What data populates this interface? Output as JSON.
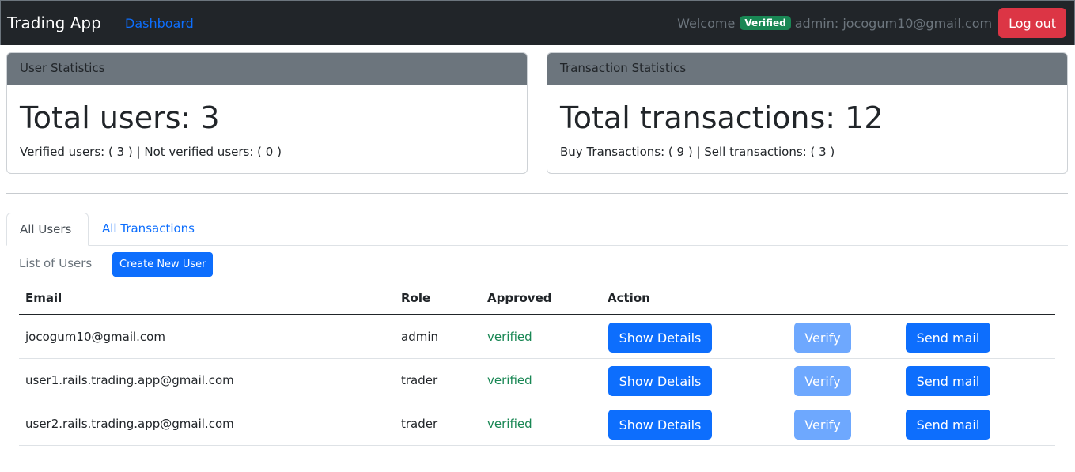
{
  "navbar": {
    "brand": "Trading App",
    "dashboard_link": "Dashboard",
    "welcome": "Welcome",
    "badge": "Verified",
    "admin_text": "admin: jocogum10@gmail.com",
    "logout": "Log out"
  },
  "user_stats": {
    "header": "User Statistics",
    "title": "Total users: 3",
    "text": "Verified users: ( 3 ) | Not verified users: ( 0 )"
  },
  "txn_stats": {
    "header": "Transaction Statistics",
    "title": "Total transactions: 12",
    "text": "Buy Transactions: ( 9 ) | Sell transactions: ( 3 )"
  },
  "tabs": [
    {
      "label": "All Users",
      "active": true
    },
    {
      "label": "All Transactions",
      "active": false
    }
  ],
  "users_section": {
    "label": "List of Users",
    "create_button": "Create New User"
  },
  "table": {
    "headers": {
      "email": "Email",
      "role": "Role",
      "approved": "Approved",
      "action": "Action"
    },
    "rows": [
      {
        "email": "jocogum10@gmail.com",
        "role": "admin",
        "approved": "verified",
        "show": "Show Details",
        "verify": "Verify",
        "mail": "Send mail"
      },
      {
        "email": "user1.rails.trading.app@gmail.com",
        "role": "trader",
        "approved": "verified",
        "show": "Show Details",
        "verify": "Verify",
        "mail": "Send mail"
      },
      {
        "email": "user2.rails.trading.app@gmail.com",
        "role": "trader",
        "approved": "verified",
        "show": "Show Details",
        "verify": "Verify",
        "mail": "Send mail"
      }
    ]
  },
  "colors": {
    "navbar_bg": "#212529",
    "primary": "#0d6efd",
    "danger": "#dc3545",
    "success": "#198754",
    "card_header": "#6c757d"
  }
}
